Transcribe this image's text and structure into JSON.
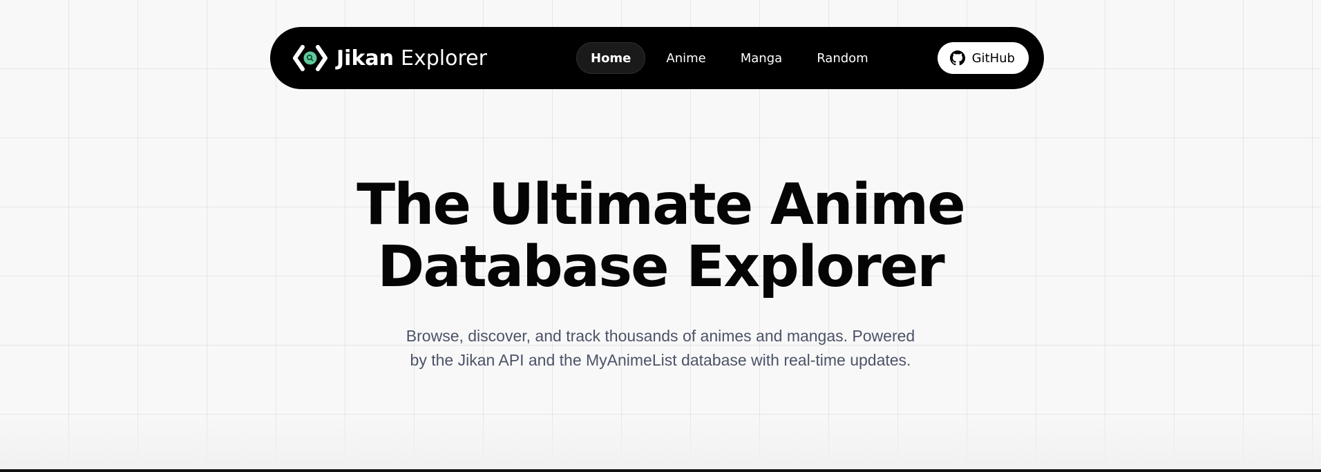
{
  "navbar": {
    "brand": {
      "logo_icon": "code-brackets-search-icon",
      "name_bold": "Jikan",
      "name_light": "Explorer",
      "accent_color": "#5fc89b"
    },
    "links": [
      {
        "label": "Home",
        "active": true
      },
      {
        "label": "Anime",
        "active": false
      },
      {
        "label": "Manga",
        "active": false
      },
      {
        "label": "Random",
        "active": false
      }
    ],
    "github": {
      "label": "GitHub",
      "icon": "github-icon"
    }
  },
  "hero": {
    "title_line1": "The Ultimate Anime",
    "title_line2": "Database Explorer",
    "subtitle_line1": "Browse, discover, and track thousands of animes and mangas. Powered",
    "subtitle_line2": "by the Jikan API and the MyAnimeList database with real-time updates."
  }
}
